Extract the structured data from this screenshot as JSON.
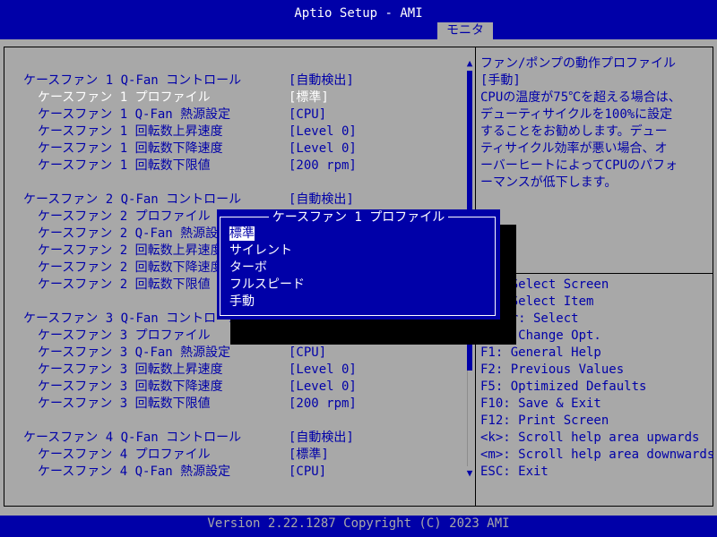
{
  "window": {
    "title": "Aptio Setup - AMI",
    "active_tab": "モニタ"
  },
  "settings": [
    {
      "label": "ケースファン 1 Q-Fan コントロール",
      "value": "[自動検出]",
      "indent": 0,
      "selected": false
    },
    {
      "label": "ケースファン 1 プロファイル",
      "value": "[標準]",
      "indent": 1,
      "selected": true
    },
    {
      "label": "ケースファン 1 Q-Fan 熱源設定",
      "value": "[CPU]",
      "indent": 1,
      "selected": false
    },
    {
      "label": "ケースファン 1 回転数上昇速度",
      "value": "[Level 0]",
      "indent": 1,
      "selected": false
    },
    {
      "label": "ケースファン 1 回転数下降速度",
      "value": "[Level 0]",
      "indent": 1,
      "selected": false
    },
    {
      "label": "ケースファン 1 回転数下限値",
      "value": "[200 rpm]",
      "indent": 1,
      "selected": false
    },
    {
      "label": "ケースファン 2 Q-Fan コントロール",
      "value": "[自動検出]",
      "indent": 0,
      "selected": false
    },
    {
      "label": "ケースファン 2 プロファイル",
      "value": "",
      "indent": 1,
      "selected": false
    },
    {
      "label": "ケースファン 2 Q-Fan 熱源設定",
      "value": "",
      "indent": 1,
      "selected": false
    },
    {
      "label": "ケースファン 2 回転数上昇速度",
      "value": "",
      "indent": 1,
      "selected": false
    },
    {
      "label": "ケースファン 2 回転数下降速度",
      "value": "",
      "indent": 1,
      "selected": false
    },
    {
      "label": "ケースファン 2 回転数下限値",
      "value": "",
      "indent": 1,
      "selected": false
    },
    {
      "label": "ケースファン 3 Q-Fan コントロール",
      "value": "",
      "indent": 0,
      "selected": false
    },
    {
      "label": "ケースファン 3 プロファイル",
      "value": "",
      "indent": 1,
      "selected": false
    },
    {
      "label": "ケースファン 3 Q-Fan 熱源設定",
      "value": "[CPU]",
      "indent": 1,
      "selected": false
    },
    {
      "label": "ケースファン 3 回転数上昇速度",
      "value": "[Level 0]",
      "indent": 1,
      "selected": false
    },
    {
      "label": "ケースファン 3 回転数下降速度",
      "value": "[Level 0]",
      "indent": 1,
      "selected": false
    },
    {
      "label": "ケースファン 3 回転数下限値",
      "value": "[200 rpm]",
      "indent": 1,
      "selected": false
    },
    {
      "label": "ケースファン 4 Q-Fan コントロール",
      "value": "[自動検出]",
      "indent": 0,
      "selected": false
    },
    {
      "label": "ケースファン 4 プロファイル",
      "value": "[標準]",
      "indent": 1,
      "selected": false
    },
    {
      "label": "ケースファン 4 Q-Fan 熱源設定",
      "value": "[CPU]",
      "indent": 1,
      "selected": false
    }
  ],
  "help": {
    "lines": [
      "ファン/ポンプの動作プロファイル",
      "[手動]",
      "CPUの温度が75℃を超える場合は、",
      "デューティサイクルを100%に設定",
      "することをお勧めします。デュー",
      "ティサイクル効率が悪い場合、オ",
      "ーバーヒートによってCPUのパフォ",
      "ーマンスが低下します。"
    ]
  },
  "keys": [
    "→←: Select Screen",
    "↑↓: Select Item",
    "Enter: Select",
    "+/-: Change Opt.",
    "F1: General Help",
    "F2: Previous Values",
    "F5: Optimized Defaults",
    "F10: Save & Exit",
    "F12: Print Screen",
    "<k>: Scroll help area upwards",
    "<m>: Scroll help area downwards",
    "ESC: Exit"
  ],
  "popup": {
    "title": "ケースファン 1 プロファイル",
    "options": [
      "標準",
      "サイレント",
      "ターボ",
      "フルスピード",
      "手動"
    ],
    "active_index": 0
  },
  "footer": {
    "text": "Version 2.22.1287 Copyright (C) 2023 AMI"
  },
  "scroll": {
    "up_icon": "▲",
    "down_icon": "▼"
  },
  "colors": {
    "bios_blue": "#0000a8",
    "panel_gray": "#a8a8a8",
    "white": "#ffffff"
  }
}
